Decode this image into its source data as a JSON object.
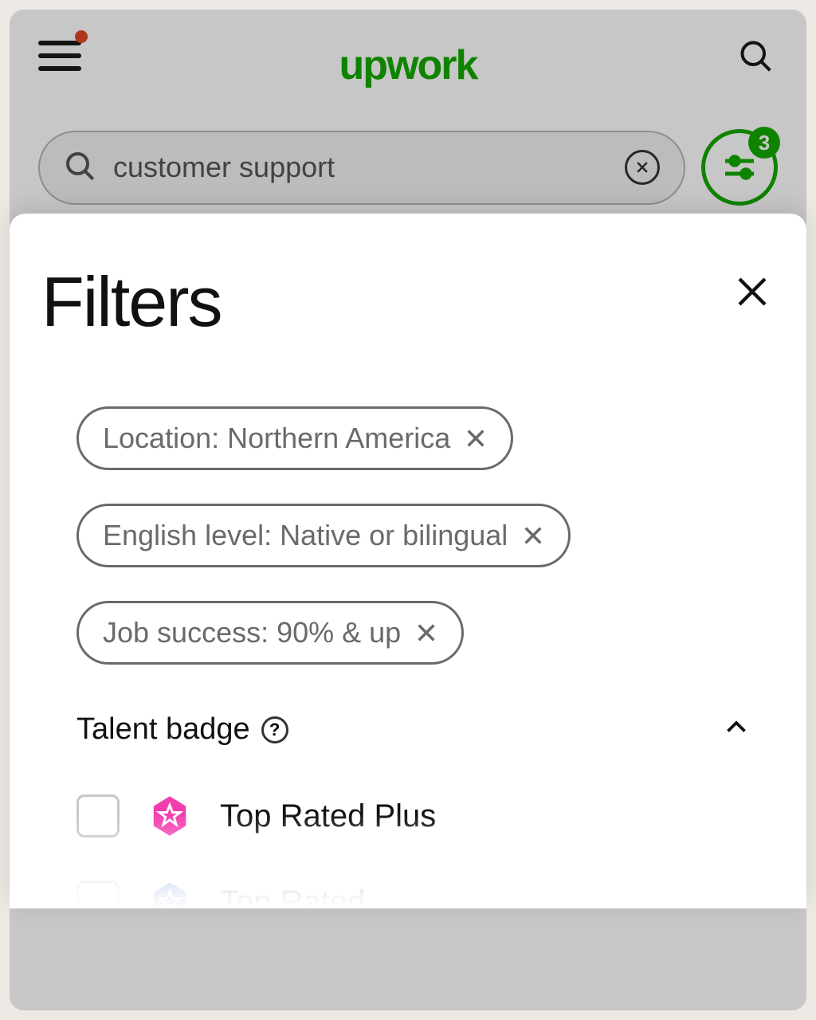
{
  "brand": "upwork",
  "search": {
    "value": "customer support"
  },
  "filter_toggle": {
    "badge_count": "3"
  },
  "filters_modal": {
    "title": "Filters",
    "chips": [
      {
        "label": "Location: Northern America"
      },
      {
        "label": "English level: Native or bilingual"
      },
      {
        "label": "Job success: 90% & up"
      }
    ],
    "section": {
      "title": "Talent badge",
      "options": [
        {
          "label": "Top Rated Plus",
          "badge_color": "#f23daf",
          "checked": false
        },
        {
          "label": "Top Rated",
          "badge_color": "#8ea6e6",
          "checked": false
        }
      ]
    }
  }
}
